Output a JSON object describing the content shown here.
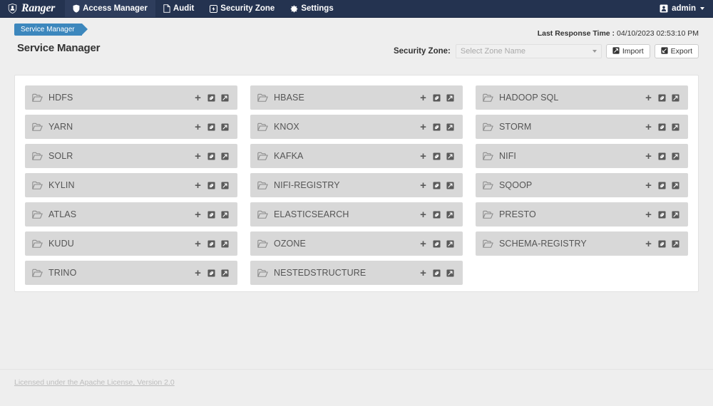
{
  "navbar": {
    "brand": "Ranger",
    "brand_icon": "ranger-shield-logo",
    "items": [
      {
        "label": "Access Manager",
        "icon": "shield-icon",
        "active": true
      },
      {
        "label": "Audit",
        "icon": "file-icon",
        "active": false
      },
      {
        "label": "Security Zone",
        "icon": "bolt-box-icon",
        "active": false
      },
      {
        "label": "Settings",
        "icon": "gear-icon",
        "active": false
      }
    ],
    "user": {
      "name": "admin",
      "icon": "user-avatar-icon",
      "caret": "chevron-down-icon"
    }
  },
  "breadcrumb": {
    "label": "Service Manager"
  },
  "header": {
    "title": "Service Manager",
    "last_response_label": "Last Response Time :",
    "last_response_value": "04/10/2023 02:53:10 PM",
    "security_zone_label": "Security Zone:",
    "zone_select_placeholder": "Select Zone Name",
    "zone_select_value": "",
    "import_label": "Import",
    "import_icon": "import-icon",
    "export_label": "Export",
    "export_icon": "export-icon"
  },
  "service_manager": {
    "card_icon": "folder-open-icon",
    "action_add_icon": "plus-icon",
    "action_edit_icon": "edit-box-icon",
    "action_open_icon": "external-link-box-icon",
    "columns": [
      {
        "services": [
          {
            "name": "HDFS"
          },
          {
            "name": "YARN"
          },
          {
            "name": "SOLR"
          },
          {
            "name": "KYLIN"
          },
          {
            "name": "ATLAS"
          },
          {
            "name": "KUDU"
          },
          {
            "name": "TRINO"
          }
        ]
      },
      {
        "services": [
          {
            "name": "HBASE"
          },
          {
            "name": "KNOX"
          },
          {
            "name": "KAFKA"
          },
          {
            "name": "NIFI-REGISTRY"
          },
          {
            "name": "ELASTICSEARCH"
          },
          {
            "name": "OZONE"
          },
          {
            "name": "NESTEDSTRUCTURE"
          }
        ]
      },
      {
        "services": [
          {
            "name": "HADOOP SQL"
          },
          {
            "name": "STORM"
          },
          {
            "name": "NIFI"
          },
          {
            "name": "SQOOP"
          },
          {
            "name": "PRESTO"
          },
          {
            "name": "SCHEMA-REGISTRY"
          }
        ]
      }
    ]
  },
  "footer": {
    "license_text": "Licensed under the Apache License, Version 2.0"
  },
  "colors": {
    "navbar_bg": "#243350",
    "navbar_active_bg": "#2e3d5c",
    "breadcrumb_blue": "#3c87bd",
    "card_bg": "#d8d8d8",
    "page_bg": "#eeeeee",
    "panel_bg": "#ffffff",
    "service_text": "#555555",
    "footer_link": "#bdbdbd"
  }
}
